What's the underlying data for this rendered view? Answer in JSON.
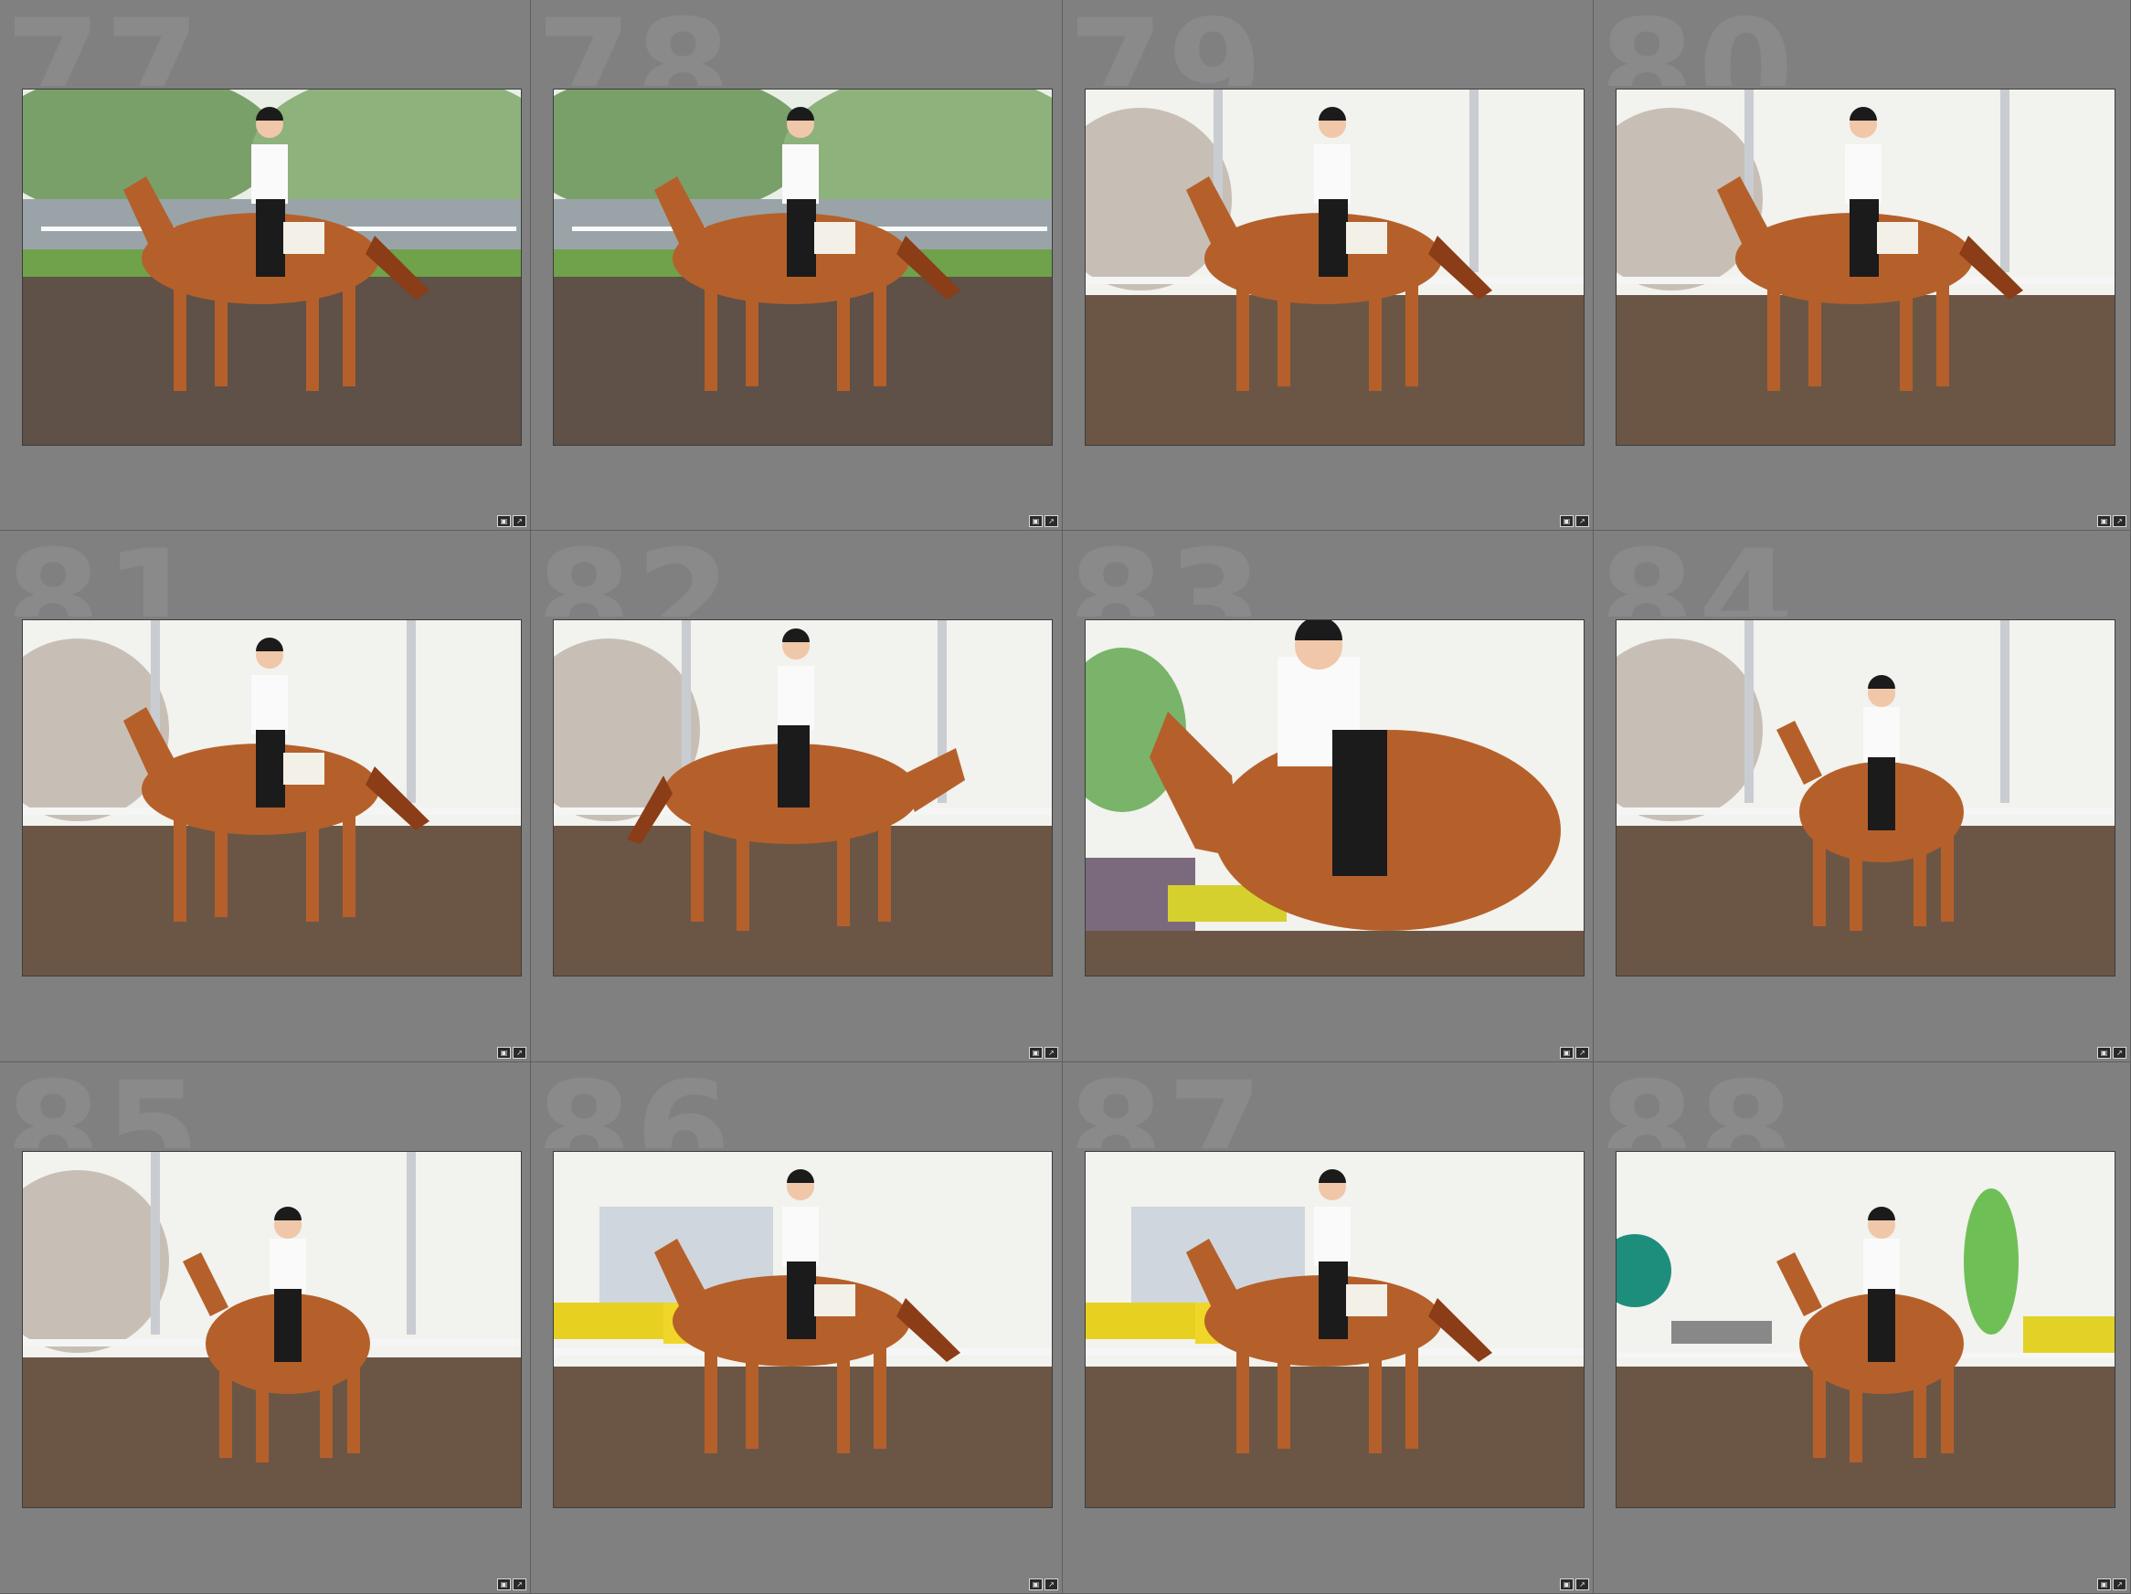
{
  "grid": {
    "cells": [
      {
        "number": "77",
        "scene": "outdoor"
      },
      {
        "number": "78",
        "scene": "outdoor"
      },
      {
        "number": "79",
        "scene": "indoor"
      },
      {
        "number": "80",
        "scene": "indoor"
      },
      {
        "number": "81",
        "scene": "indoor"
      },
      {
        "number": "82",
        "scene": "indoor-left"
      },
      {
        "number": "83",
        "scene": "closeup"
      },
      {
        "number": "84",
        "scene": "front"
      },
      {
        "number": "85",
        "scene": "front"
      },
      {
        "number": "86",
        "scene": "yellow"
      },
      {
        "number": "87",
        "scene": "yellow"
      },
      {
        "number": "88",
        "scene": "trailer"
      }
    ]
  },
  "colors": {
    "cell_bg": "#808080",
    "number": "#8a8a8a",
    "horse": "#b5602a",
    "arena": "#6b5646",
    "sky": "#f2f2ee",
    "grass": "#6fa24a"
  },
  "icons": [
    "metadata-badge-icon",
    "edit-badge-icon"
  ]
}
